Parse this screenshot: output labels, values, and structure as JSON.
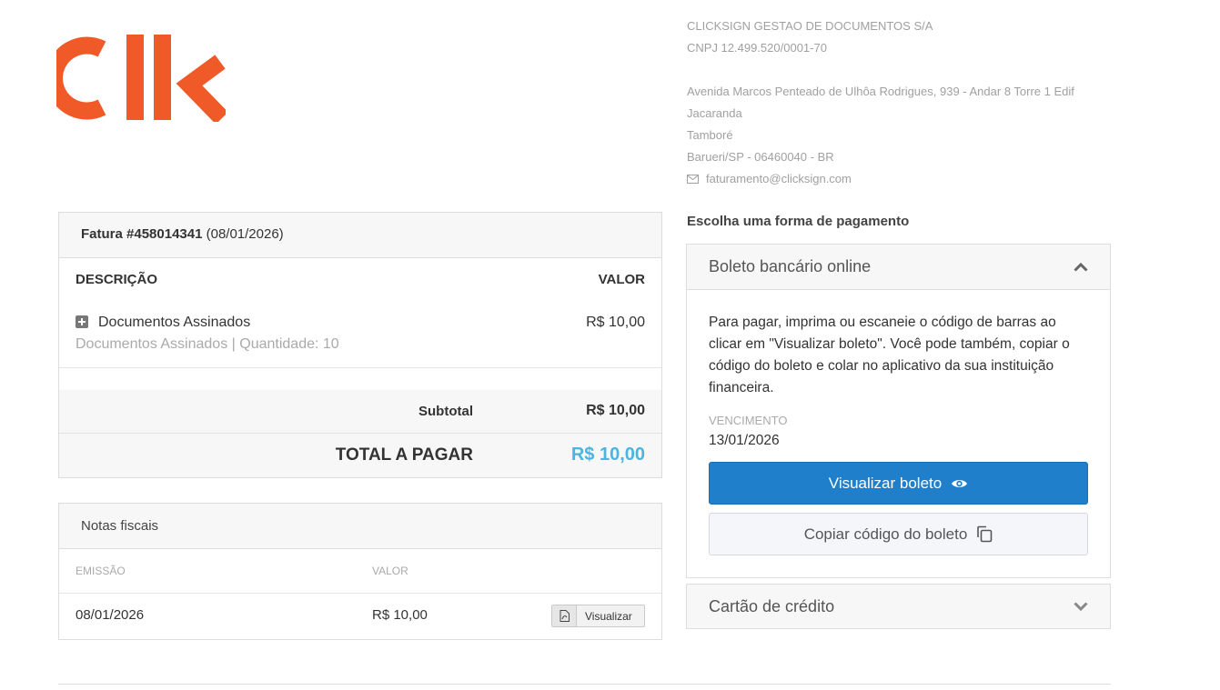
{
  "logo": {
    "text": "Clk",
    "color": "#f05a28"
  },
  "company": {
    "name": "CLICKSIGN GESTAO DE DOCUMENTOS S/A",
    "cnpj": "CNPJ 12.499.520/0001-70",
    "address_line1": "Avenida Marcos Penteado de Ulhôa Rodrigues, 939 - Andar 8 Torre 1 Edif",
    "address_line2": "Jacaranda",
    "address_line3": "Tamboré",
    "address_line4": "Barueri/SP - 06460040 - BR",
    "email": "faturamento@clicksign.com",
    "email_icon": "envelope-icon"
  },
  "invoice": {
    "title_bold": "Fatura #458014341",
    "title_date": "(08/01/2026)",
    "col_description": "DESCRIÇÃO",
    "col_value": "VALOR",
    "items": [
      {
        "icon": "plus-square-icon",
        "name": "Documentos Assinados",
        "detail": "Documentos Assinados | Quantidade: 10",
        "value": "R$ 10,00"
      }
    ],
    "subtotal_label": "Subtotal",
    "subtotal_value": "R$ 10,00",
    "total_label": "TOTAL A PAGAR",
    "total_value": "R$ 10,00",
    "total_color": "#4ab5e0"
  },
  "notas": {
    "title": "Notas fiscais",
    "col_emissao": "EMISSÃO",
    "col_valor": "VALOR",
    "rows": [
      {
        "emissao": "08/01/2026",
        "valor": "R$ 10,00",
        "button_label": "Visualizar",
        "button_icon": "pdf-file-icon"
      }
    ]
  },
  "payment": {
    "title": "Escolha uma forma de pagamento",
    "boleto": {
      "header": "Boleto bancário online",
      "expanded": true,
      "header_icon": "chevron-up-icon",
      "description": "Para pagar, imprima ou escaneie o código de barras ao clicar em \"Visualizar boleto\". Você pode também, copiar o código do boleto e colar no aplicativo da sua instituição financeira.",
      "vencimento_label": "VENCIMENTO",
      "vencimento_value": "13/01/2026",
      "primary_button": "Visualizar boleto",
      "primary_icon": "eye-icon",
      "primary_color": "#1f7fcb",
      "secondary_button": "Copiar código do boleto",
      "secondary_icon": "copy-icon"
    },
    "cartao": {
      "header": "Cartão de crédito",
      "expanded": false,
      "header_icon": "chevron-down-icon"
    }
  }
}
